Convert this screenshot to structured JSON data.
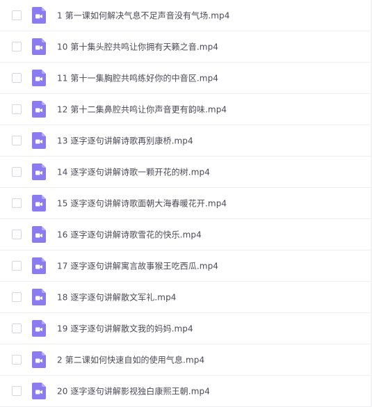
{
  "file_icon": "video-file-icon",
  "colors": {
    "icon_purple": "#8a7bf0",
    "text": "#4a4a55",
    "divider": "#eeeef0"
  },
  "files": [
    {
      "name": "1 第一课如何解决气息不足声音没有气场.mp4"
    },
    {
      "name": "10 第十集头腔共鸣让你拥有天籁之音.mp4"
    },
    {
      "name": "11 第十一集胸腔共鸣练好你的中音区.mp4"
    },
    {
      "name": "12 第十二集鼻腔共鸣让你声音更有韵味.mp4"
    },
    {
      "name": "13 逐字逐句讲解诗歌再别康桥.mp4"
    },
    {
      "name": "14 逐字逐句讲解诗歌一颗开花的树.mp4"
    },
    {
      "name": "15 逐字逐句讲解诗歌面朝大海春暖花开.mp4"
    },
    {
      "name": "16 逐字逐句讲解诗歌雪花的快乐.mp4"
    },
    {
      "name": "17 逐字逐句讲解寓言故事猴王吃西瓜.mp4"
    },
    {
      "name": "18 逐字逐句讲解散文军礼.mp4"
    },
    {
      "name": "19 逐字逐句讲解散文我的妈妈.mp4"
    },
    {
      "name": "2 第二课如何快速自如的使用气息.mp4"
    },
    {
      "name": "20 逐字逐句讲解影视独白康熙王朝.mp4"
    }
  ]
}
